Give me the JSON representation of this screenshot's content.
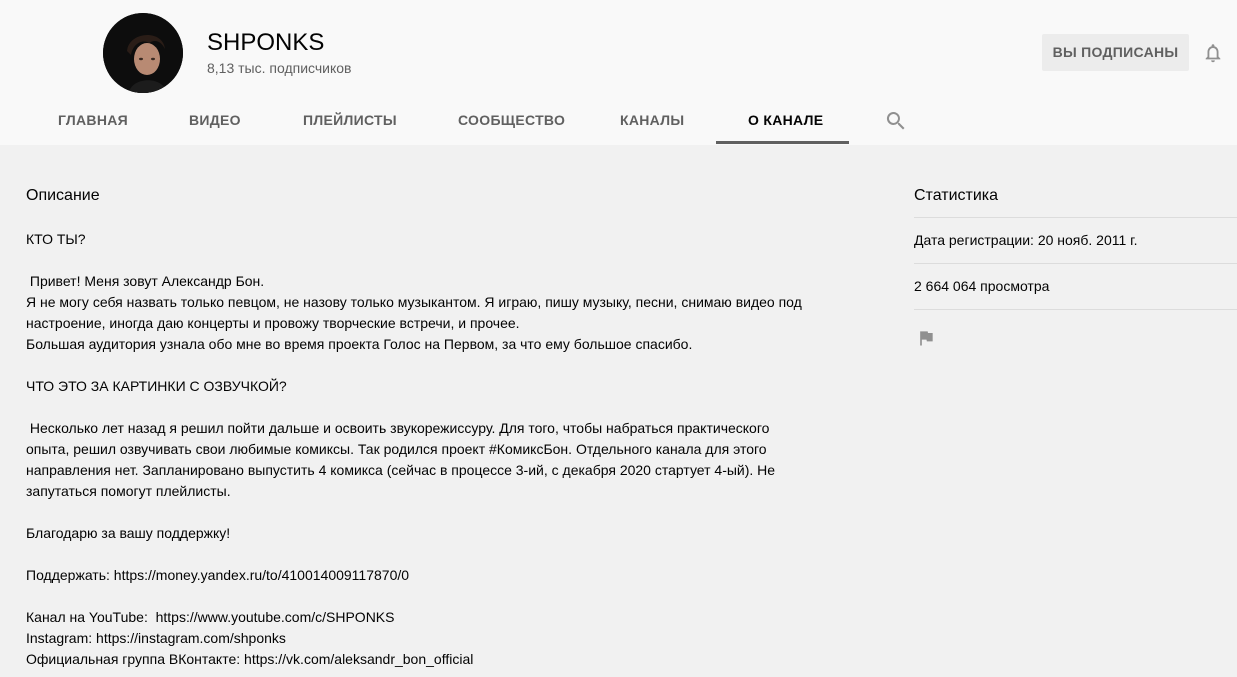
{
  "channel": {
    "name": "SHPONKS",
    "subscribers": "8,13 тыс. подписчиков",
    "subscribe_label": "ВЫ ПОДПИСАНЫ"
  },
  "tabs": [
    {
      "label": "ГЛАВНАЯ"
    },
    {
      "label": "ВИДЕО"
    },
    {
      "label": "ПЛЕЙЛИСТЫ"
    },
    {
      "label": "СООБЩЕСТВО"
    },
    {
      "label": "КАНАЛЫ"
    },
    {
      "label": "О КАНАЛЕ"
    }
  ],
  "description": {
    "title": "Описание",
    "lines": [
      "КТО ТЫ?",
      "",
      " Привет! Меня зовут Александр Бон.",
      "Я не могу себя назвать только певцом, не назову только музыкантом. Я играю, пишу музыку, песни, снимаю видео под",
      "настроение, иногда даю концерты и провожу творческие встречи, и прочее.",
      "Большая аудитория узнала обо мне во время проекта Голос на Первом, за что ему большое спасибо.",
      "",
      "ЧТО ЭТО ЗА КАРТИНКИ С ОЗВУЧКОЙ?",
      "",
      " Несколько лет назад я решил пойти дальше и освоить звукорежиссуру. Для того, чтобы набраться практического",
      "опыта, решил озвучивать свои любимые комиксы. Так родился проект #КомиксБон. Отдельного канала для этого",
      "направления нет. Запланировано выпустить 4 комикса (сейчас в процессе 3-ий, с декабря 2020 стартует 4-ый). Не",
      "запутаться помогут плейлисты.",
      "",
      "Благодарю за вашу поддержку!",
      "",
      "Поддержать: https://money.yandex.ru/to/410014009117870/0",
      "",
      "Канал на YouTube:  https://www.youtube.com/c/SHPONKS",
      "Instagram: https://instagram.com/shponks",
      "Официальная группа ВКонтакте: https://vk.com/aleksandr_bon_official"
    ]
  },
  "stats": {
    "title": "Статистика",
    "registration": "Дата регистрации: 20 нояб. 2011 г.",
    "views": "2 664 064 просмотра"
  },
  "icons": {
    "bell": "bell-icon",
    "search": "search-icon",
    "flag": "flag-icon"
  },
  "colors": {
    "header_bg": "#f9f9f9",
    "page_bg": "#f1f1f1",
    "muted_text": "#606060",
    "button_bg": "#ececec"
  }
}
